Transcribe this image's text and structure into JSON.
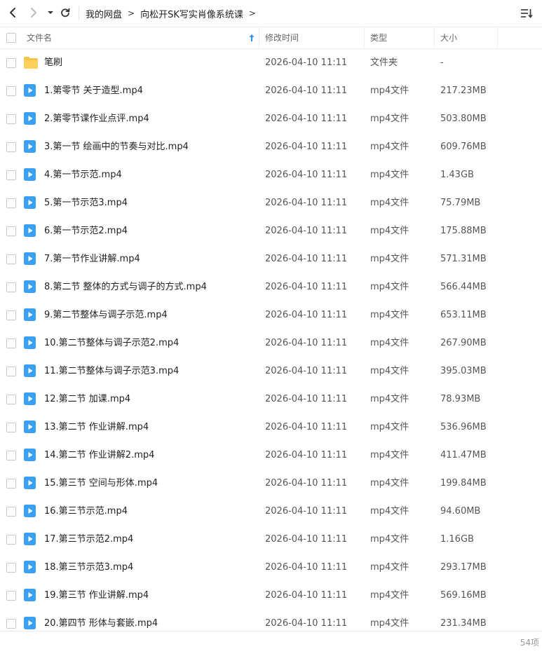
{
  "breadcrumb": {
    "root": "我的网盘",
    "folder": "向松开SK写实肖像系统课",
    "sep": ">"
  },
  "columns": {
    "name": "文件名",
    "date": "修改时间",
    "type": "类型",
    "size": "大小"
  },
  "files": [
    {
      "name": "笔刷",
      "date": "2026-04-10 11:11",
      "type": "文件夹",
      "size": "-",
      "icon": "folder-icon"
    },
    {
      "name": "1.第零节 关于造型.mp4",
      "date": "2026-04-10 11:11",
      "type": "mp4文件",
      "size": "217.23MB",
      "icon": "video-file-icon"
    },
    {
      "name": "2.第零节课作业点评.mp4",
      "date": "2026-04-10 11:11",
      "type": "mp4文件",
      "size": "503.80MB",
      "icon": "video-file-icon"
    },
    {
      "name": "3.第一节 绘画中的节奏与对比.mp4",
      "date": "2026-04-10 11:11",
      "type": "mp4文件",
      "size": "609.76MB",
      "icon": "video-file-icon"
    },
    {
      "name": "4.第一节示范.mp4",
      "date": "2026-04-10 11:11",
      "type": "mp4文件",
      "size": "1.43GB",
      "icon": "video-file-icon"
    },
    {
      "name": "5.第一节示范3.mp4",
      "date": "2026-04-10 11:11",
      "type": "mp4文件",
      "size": "75.79MB",
      "icon": "video-file-icon"
    },
    {
      "name": "6.第一节示范2.mp4",
      "date": "2026-04-10 11:11",
      "type": "mp4文件",
      "size": "175.88MB",
      "icon": "video-file-icon"
    },
    {
      "name": "7.第一节作业讲解.mp4",
      "date": "2026-04-10 11:11",
      "type": "mp4文件",
      "size": "571.31MB",
      "icon": "video-file-icon"
    },
    {
      "name": "8.第二节 整体的方式与调子的方式.mp4",
      "date": "2026-04-10 11:11",
      "type": "mp4文件",
      "size": "566.44MB",
      "icon": "video-file-icon"
    },
    {
      "name": "9.第二节整体与调子示范.mp4",
      "date": "2026-04-10 11:11",
      "type": "mp4文件",
      "size": "653.11MB",
      "icon": "video-file-icon"
    },
    {
      "name": "10.第二节整体与调子示范2.mp4",
      "date": "2026-04-10 11:11",
      "type": "mp4文件",
      "size": "267.90MB",
      "icon": "video-file-icon"
    },
    {
      "name": "11.第二节整体与调子示范3.mp4",
      "date": "2026-04-10 11:11",
      "type": "mp4文件",
      "size": "395.03MB",
      "icon": "video-file-icon"
    },
    {
      "name": "12.第二节 加课.mp4",
      "date": "2026-04-10 11:11",
      "type": "mp4文件",
      "size": "78.93MB",
      "icon": "video-file-icon"
    },
    {
      "name": "13.第二节 作业讲解.mp4",
      "date": "2026-04-10 11:11",
      "type": "mp4文件",
      "size": "536.96MB",
      "icon": "video-file-icon"
    },
    {
      "name": "14.第二节 作业讲解2.mp4",
      "date": "2026-04-10 11:11",
      "type": "mp4文件",
      "size": "411.47MB",
      "icon": "video-file-icon"
    },
    {
      "name": "15.第三节 空间与形体.mp4",
      "date": "2026-04-10 11:11",
      "type": "mp4文件",
      "size": "199.84MB",
      "icon": "video-file-icon"
    },
    {
      "name": "16.第三节示范.mp4",
      "date": "2026-04-10 11:11",
      "type": "mp4文件",
      "size": "94.60MB",
      "icon": "video-file-icon"
    },
    {
      "name": "17.第三节示范2.mp4",
      "date": "2026-04-10 11:11",
      "type": "mp4文件",
      "size": "1.16GB",
      "icon": "video-file-icon"
    },
    {
      "name": "18.第三节示范3.mp4",
      "date": "2026-04-10 11:11",
      "type": "mp4文件",
      "size": "293.17MB",
      "icon": "video-file-icon"
    },
    {
      "name": "19.第三节 作业讲解.mp4",
      "date": "2026-04-10 11:11",
      "type": "mp4文件",
      "size": "569.16MB",
      "icon": "video-file-icon"
    },
    {
      "name": "20.第四节 形体与套嵌.mp4",
      "date": "2026-04-10 11:11",
      "type": "mp4文件",
      "size": "231.34MB",
      "icon": "video-file-icon"
    }
  ],
  "footer": {
    "count": "54项"
  },
  "colors": {
    "accent": "#2f8ff3",
    "folder": "#f7c545",
    "video": "#3aa0f0"
  }
}
